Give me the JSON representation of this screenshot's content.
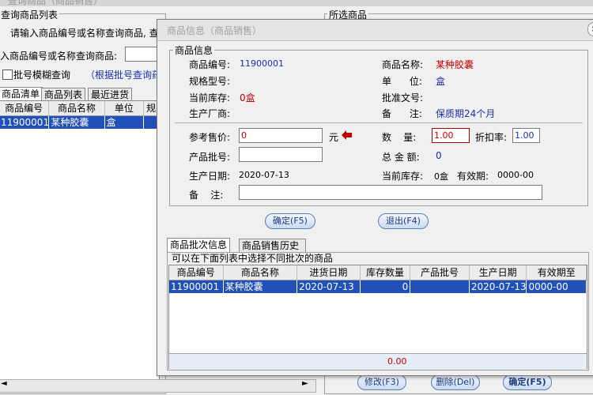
{
  "background_window": {
    "title": "查询商品（商品销售）",
    "left_group_label": "查询商品列表",
    "prompt_text": "请输入商品编号或名称查询商品, 查",
    "search_label": "入商品编号或名称查询商品:",
    "search_value": "",
    "batch_fuzzy_label": "批号模糊查询",
    "batch_hint": "（根据批号查询药",
    "tabs": [
      "商品清单",
      "商品列表",
      "最近进货"
    ],
    "columns": [
      "商品编号",
      "商品名称",
      "单位",
      "规"
    ],
    "rows": [
      [
        "11900001",
        "某种胶囊",
        "盒",
        ""
      ]
    ],
    "right_group_label": "所选商品",
    "bottom_buttons": [
      "修改(F3)",
      "删除(Del)",
      "确定(F5)"
    ]
  },
  "dialog": {
    "title": "商品信息（商品销售）",
    "info_group_label": "商品信息",
    "fields": {
      "code_label": "商品编号:",
      "code_value": "11900001",
      "name_label": "商品名称:",
      "name_value": "某种胶囊",
      "spec_label": "规格型号:",
      "spec_value": "",
      "unit_label": "单      位:",
      "unit_value": "盒",
      "stock_label": "当前库存:",
      "stock_value": "0盒",
      "approval_label": "批准文号:",
      "approval_value": "",
      "maker_label": "生产厂商:",
      "maker_value": "",
      "note_label": "备      注:",
      "note_value": "保质期24个月"
    },
    "form": {
      "price_label": "参考售价:",
      "price_value": "0",
      "price_unit": "元",
      "qty_label": "数    量:",
      "qty_value": "1.00",
      "discount_label": "折扣率:",
      "discount_value": "1.00",
      "batch_label": "产品批号:",
      "batch_value": "",
      "total_label": "总 金 额:",
      "total_value": "0",
      "prod_date_label": "生产日期:",
      "prod_date_value": "2020-07-13",
      "cur_stock_label": "当前库存:",
      "cur_stock_value": "0盒",
      "expiry_label": "有效期:",
      "expiry_value": "0000-00",
      "remark_label": "备    注:",
      "remark_value": ""
    },
    "ok_button": "确定(F5)",
    "exit_button": "退出(F4)",
    "tabs": [
      "商品批次信息",
      "商品销售历史"
    ],
    "batch_group_label": "可以在下面列表中选择不同批次的商品",
    "columns": [
      "商品编号",
      "商品名称",
      "进货日期",
      "库存数量",
      "产品批号",
      "生产日期",
      "有效期至"
    ],
    "rows": [
      [
        "11900001",
        "某种胶囊",
        "2020-07-13",
        "0",
        "",
        "2020-07-13",
        "0000-00"
      ]
    ],
    "footer_total": "0.00"
  },
  "colors": {
    "selection": "#2050b8",
    "accent_red": "#c00000",
    "value_blue": "#1a2fa6"
  }
}
